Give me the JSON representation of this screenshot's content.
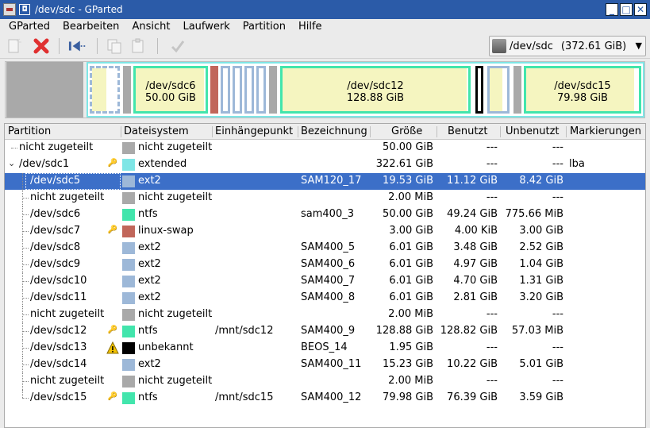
{
  "window": {
    "title": "/dev/sdc - GParted",
    "app_icon": "gparted-icon",
    "window_menu_icon": "window-menu-icon",
    "buttons": [
      {
        "name": "minimize-icon",
        "glyph": "_"
      },
      {
        "name": "maximize-icon",
        "glyph": "□"
      },
      {
        "name": "close-icon",
        "glyph": "✕"
      }
    ]
  },
  "menubar": {
    "items": [
      "GParted",
      "Bearbeiten",
      "Ansicht",
      "Laufwerk",
      "Partition",
      "Hilfe"
    ]
  },
  "toolbar": {
    "buttons": [
      {
        "name": "new-partition-icon",
        "enabled": false
      },
      {
        "name": "delete-partition-icon",
        "enabled": true,
        "color": "#e03030"
      },
      {
        "name": "resize-move-icon",
        "enabled": true,
        "color": "#3a5fa0"
      },
      {
        "name": "copy-icon",
        "enabled": false
      },
      {
        "name": "paste-icon",
        "enabled": false
      },
      {
        "name": "apply-checkmark-icon",
        "enabled": false
      }
    ],
    "device_selector": {
      "device": "/dev/sdc",
      "size": "(372.61 GiB)",
      "icon": "hard-disk-icon"
    }
  },
  "visual_map": {
    "labels": {
      "sdc6": {
        "name": "/dev/sdc6",
        "size": "50.00 GiB"
      },
      "sdc12": {
        "name": "/dev/sdc12",
        "size": "128.88 GiB"
      },
      "sdc15": {
        "name": "/dev/sdc15",
        "size": "79.98 GiB"
      }
    },
    "colors": {
      "unallocated": "#a9a9a9",
      "extended": "#7fe6e6",
      "ext2": "#9db8d8",
      "ntfs": "#42e5ac",
      "linux_swap": "#c1665a",
      "unknown": "#000000",
      "used": "#f5f5c0"
    }
  },
  "table": {
    "columns": [
      "Partition",
      "Dateisystem",
      "Einhängepunkt",
      "Bezeichnung",
      "Größe",
      "Benutzt",
      "Unbenutzt",
      "Markierungen"
    ],
    "rows": [
      {
        "partition": "nicht zugeteilt",
        "fs": "nicht zugeteilt",
        "mount": "",
        "label": "",
        "size": "50.00 GiB",
        "used": "---",
        "unused": "---",
        "flags": "",
        "color": "#a9a9a9",
        "lock": false,
        "warn": false,
        "level": 0
      },
      {
        "partition": "/dev/sdc1",
        "fs": "extended",
        "mount": "",
        "label": "",
        "size": "322.61 GiB",
        "used": "---",
        "unused": "---",
        "flags": "lba",
        "color": "#7fe6e6",
        "lock": true,
        "warn": false,
        "level": 0,
        "expanded": true
      },
      {
        "partition": "/dev/sdc5",
        "fs": "ext2",
        "mount": "",
        "label": "SAM120_17",
        "size": "19.53 GiB",
        "used": "11.12 GiB",
        "unused": "8.42 GiB",
        "flags": "",
        "color": "#9db8d8",
        "lock": false,
        "warn": false,
        "level": 1,
        "selected": true
      },
      {
        "partition": "nicht zugeteilt",
        "fs": "nicht zugeteilt",
        "mount": "",
        "label": "",
        "size": "2.00 MiB",
        "used": "---",
        "unused": "---",
        "flags": "",
        "color": "#a9a9a9",
        "lock": false,
        "warn": false,
        "level": 1
      },
      {
        "partition": "/dev/sdc6",
        "fs": "ntfs",
        "mount": "",
        "label": "sam400_3",
        "size": "50.00 GiB",
        "used": "49.24 GiB",
        "unused": "775.66 MiB",
        "flags": "",
        "color": "#42e5ac",
        "lock": false,
        "warn": false,
        "level": 1
      },
      {
        "partition": "/dev/sdc7",
        "fs": "linux-swap",
        "mount": "",
        "label": "",
        "size": "3.00 GiB",
        "used": "4.00 KiB",
        "unused": "3.00 GiB",
        "flags": "",
        "color": "#c1665a",
        "lock": true,
        "warn": false,
        "level": 1
      },
      {
        "partition": "/dev/sdc8",
        "fs": "ext2",
        "mount": "",
        "label": "SAM400_5",
        "size": "6.01 GiB",
        "used": "3.48 GiB",
        "unused": "2.52 GiB",
        "flags": "",
        "color": "#9db8d8",
        "lock": false,
        "warn": false,
        "level": 1
      },
      {
        "partition": "/dev/sdc9",
        "fs": "ext2",
        "mount": "",
        "label": "SAM400_6",
        "size": "6.01 GiB",
        "used": "4.97 GiB",
        "unused": "1.04 GiB",
        "flags": "",
        "color": "#9db8d8",
        "lock": false,
        "warn": false,
        "level": 1
      },
      {
        "partition": "/dev/sdc10",
        "fs": "ext2",
        "mount": "",
        "label": "SAM400_7",
        "size": "6.01 GiB",
        "used": "4.70 GiB",
        "unused": "1.31 GiB",
        "flags": "",
        "color": "#9db8d8",
        "lock": false,
        "warn": false,
        "level": 1
      },
      {
        "partition": "/dev/sdc11",
        "fs": "ext2",
        "mount": "",
        "label": "SAM400_8",
        "size": "6.01 GiB",
        "used": "2.81 GiB",
        "unused": "3.20 GiB",
        "flags": "",
        "color": "#9db8d8",
        "lock": false,
        "warn": false,
        "level": 1
      },
      {
        "partition": "nicht zugeteilt",
        "fs": "nicht zugeteilt",
        "mount": "",
        "label": "",
        "size": "2.00 MiB",
        "used": "---",
        "unused": "---",
        "flags": "",
        "color": "#a9a9a9",
        "lock": false,
        "warn": false,
        "level": 1
      },
      {
        "partition": "/dev/sdc12",
        "fs": "ntfs",
        "mount": "/mnt/sdc12",
        "label": "SAM400_9",
        "size": "128.88 GiB",
        "used": "128.82 GiB",
        "unused": "57.03 MiB",
        "flags": "",
        "color": "#42e5ac",
        "lock": true,
        "warn": false,
        "level": 1
      },
      {
        "partition": "/dev/sdc13",
        "fs": "unbekannt",
        "mount": "",
        "label": "BEOS_14",
        "size": "1.95 GiB",
        "used": "---",
        "unused": "---",
        "flags": "",
        "color": "#000000",
        "lock": false,
        "warn": true,
        "level": 1
      },
      {
        "partition": "/dev/sdc14",
        "fs": "ext2",
        "mount": "",
        "label": "SAM400_11",
        "size": "15.23 GiB",
        "used": "10.22 GiB",
        "unused": "5.01 GiB",
        "flags": "",
        "color": "#9db8d8",
        "lock": false,
        "warn": false,
        "level": 1
      },
      {
        "partition": "nicht zugeteilt",
        "fs": "nicht zugeteilt",
        "mount": "",
        "label": "",
        "size": "2.00 MiB",
        "used": "---",
        "unused": "---",
        "flags": "",
        "color": "#a9a9a9",
        "lock": false,
        "warn": false,
        "level": 1
      },
      {
        "partition": "/dev/sdc15",
        "fs": "ntfs",
        "mount": "/mnt/sdc15",
        "label": "SAM400_12",
        "size": "79.98 GiB",
        "used": "76.39 GiB",
        "unused": "3.59 GiB",
        "flags": "",
        "color": "#42e5ac",
        "lock": true,
        "warn": false,
        "level": 1
      }
    ]
  }
}
